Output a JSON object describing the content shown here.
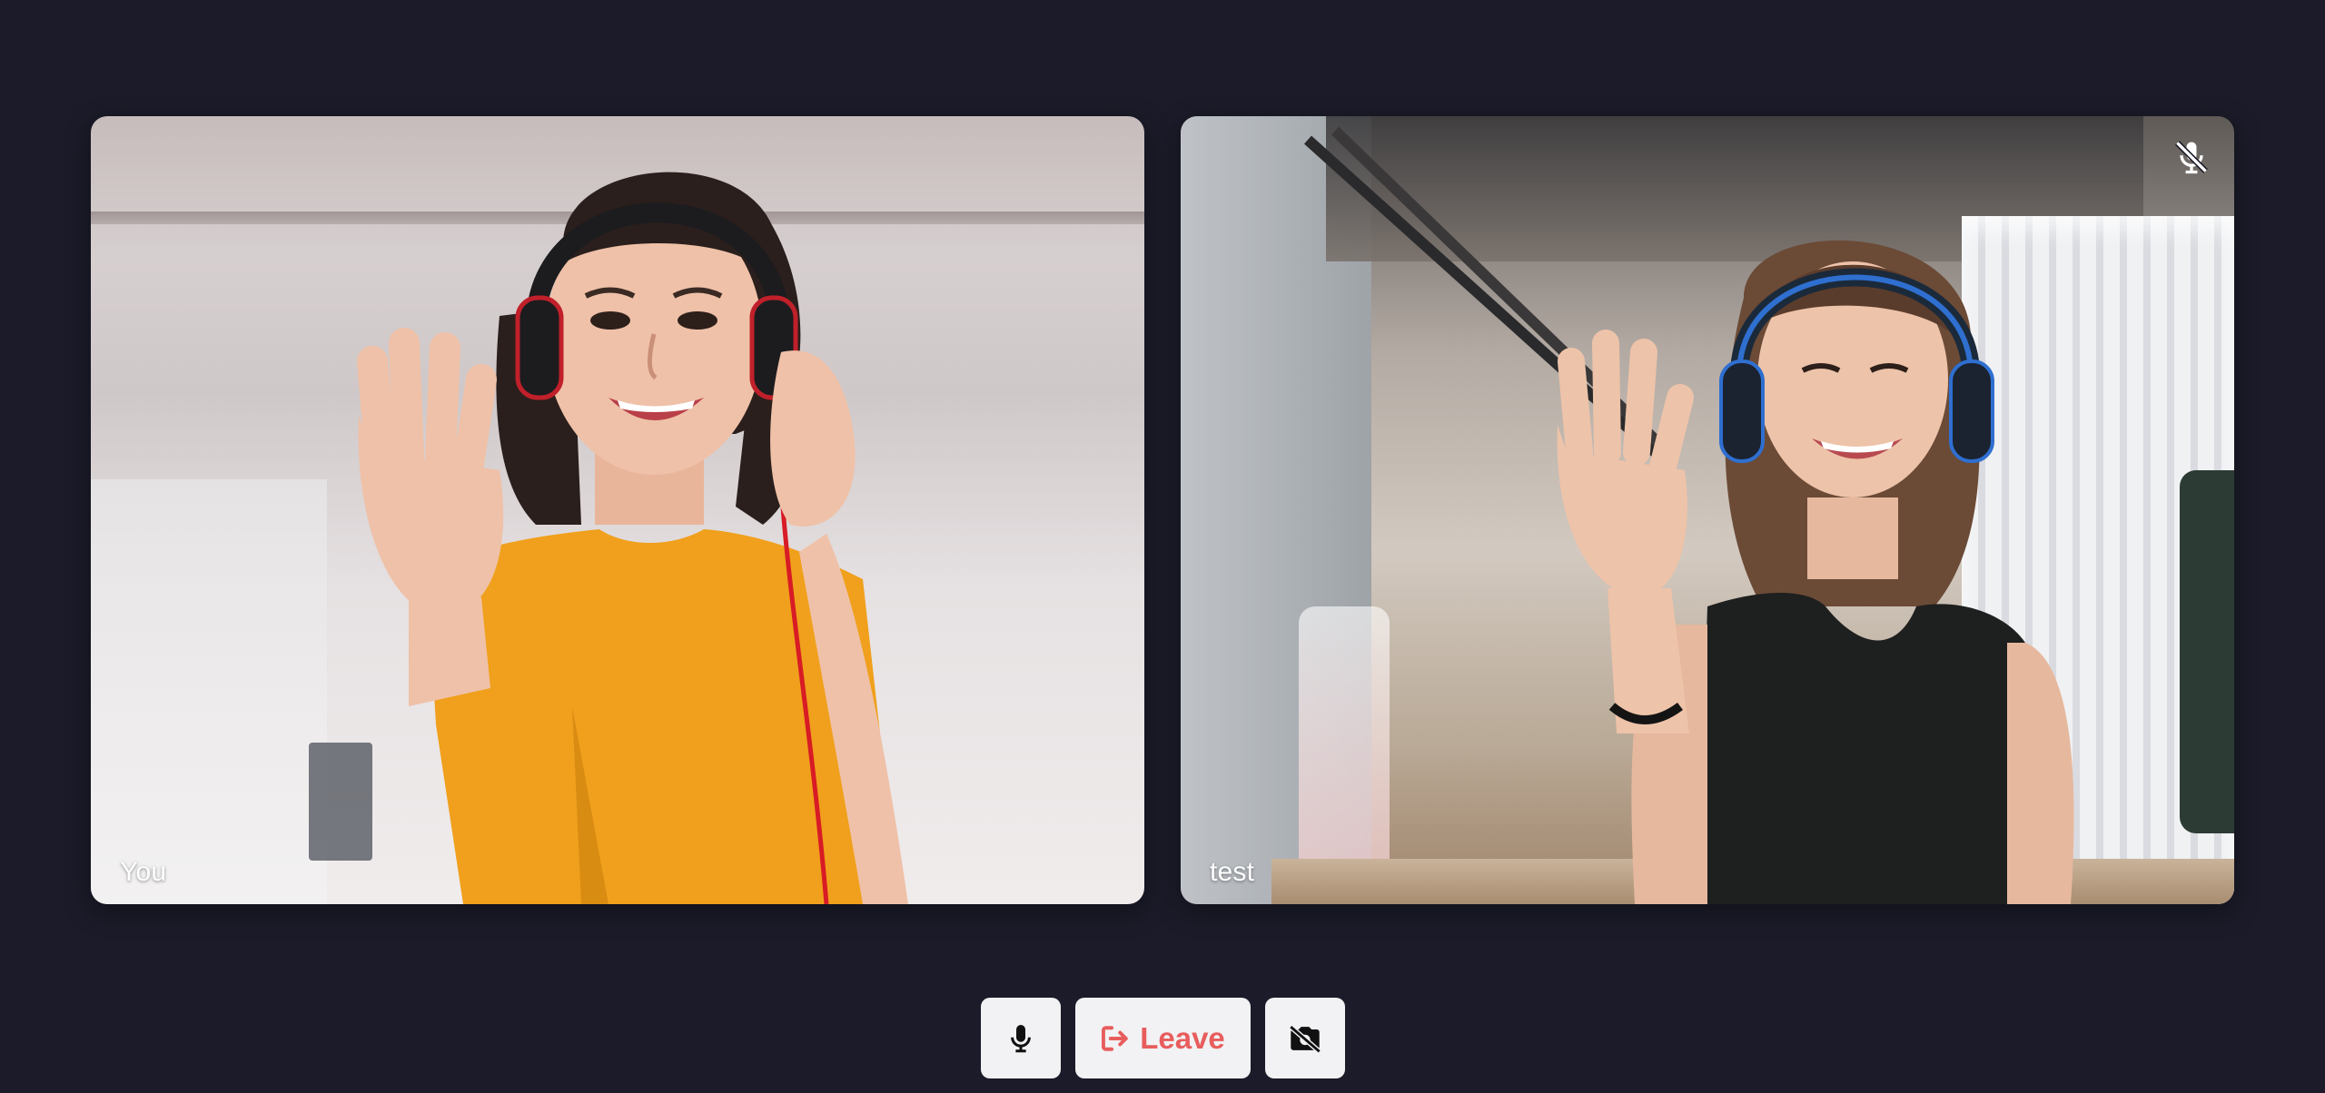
{
  "call": {
    "participants": [
      {
        "label": "You",
        "muted": false
      },
      {
        "label": "test",
        "muted": true
      }
    ]
  },
  "controls": {
    "mic_icon": "microphone-icon",
    "leave_label": "Leave",
    "leave_icon": "sign-out-icon",
    "camera_icon": "video-off-icon"
  },
  "colors": {
    "background": "#1b1b29",
    "button_bg": "#f2f2f4",
    "leave_accent": "#e85d5d",
    "label_text": "#ffffff"
  }
}
